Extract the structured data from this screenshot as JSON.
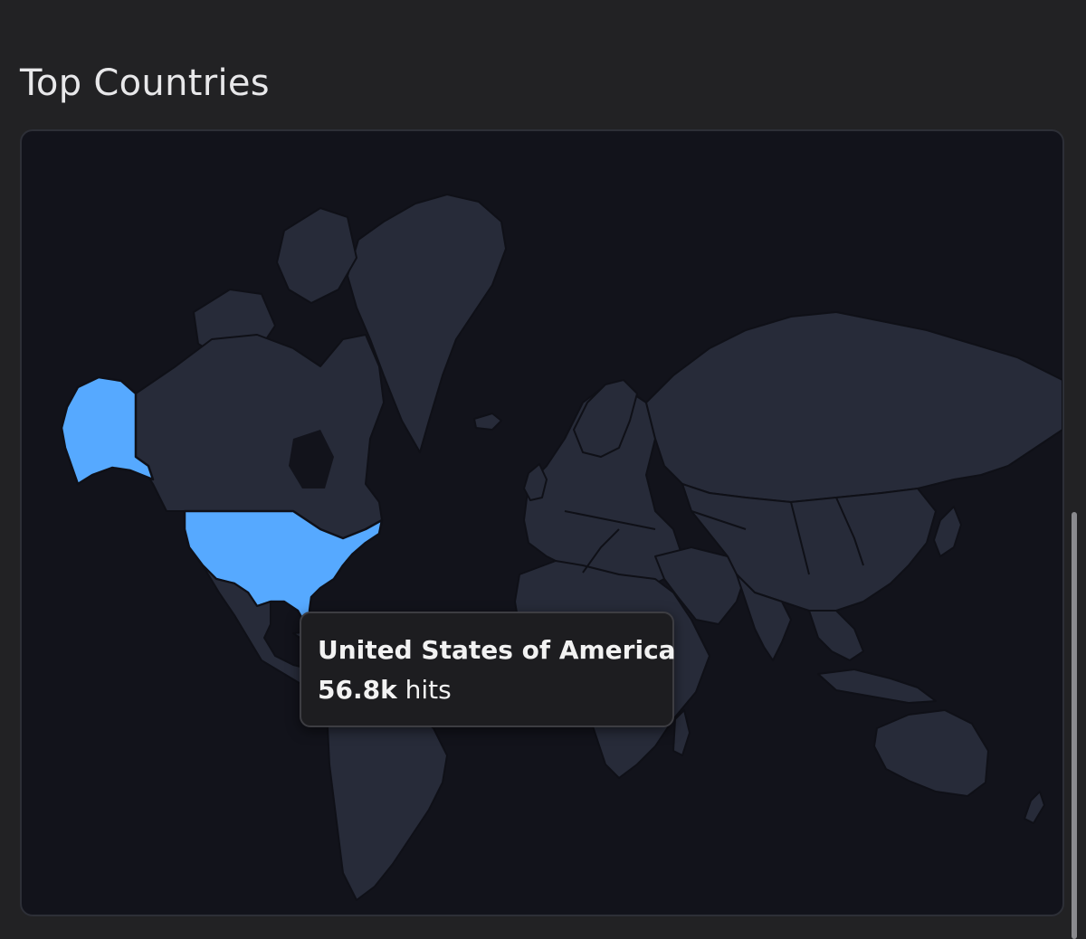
{
  "section": {
    "title": "Top Countries"
  },
  "map": {
    "highlighted_country": "United States of America",
    "colors": {
      "land": "#272b39",
      "ocean": "#12131b",
      "highlight": "#56a9ff",
      "border": "#0f1017"
    }
  },
  "tooltip": {
    "country": "United States of America",
    "value": "56.8k",
    "unit": "hits"
  }
}
